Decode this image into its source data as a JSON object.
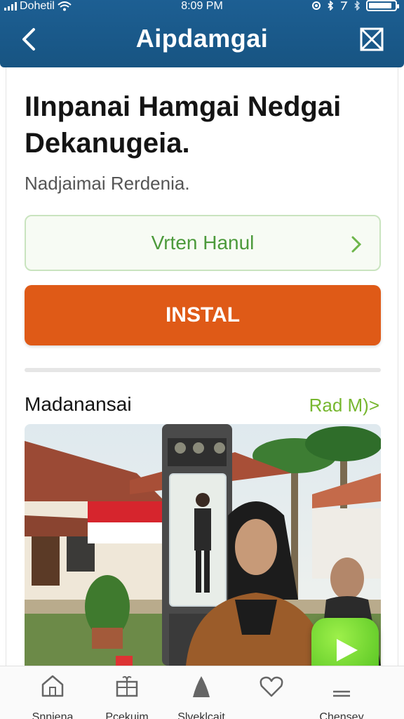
{
  "status_bar": {
    "carrier": "Dohetil",
    "time": "8:09 PM",
    "battery_level": 0.9
  },
  "header": {
    "title": "Aipdamgai",
    "back_icon": "chevron-left-icon",
    "close_icon": "close-box-icon"
  },
  "main": {
    "headline": "IInpanai Hamgai Nedgai Dekanugeia.",
    "subline": "Nadjaimai Rerdenia.",
    "link_row_label": "Vrten Hanul",
    "install_label": "INSTAL",
    "section_title": "Madanansai",
    "read_more": "Rad M)>"
  },
  "tabs": [
    {
      "label": "Snniena",
      "icon": "home-icon"
    },
    {
      "label": "Pcekuim",
      "icon": "gift-icon"
    },
    {
      "label": "Slveklcait",
      "icon": "person-icon"
    },
    {
      "label": "",
      "icon": "heart-icon"
    },
    {
      "label": "Chensey",
      "icon": "menu-icon"
    }
  ],
  "colors": {
    "header_blue": "#1a5a8c",
    "install_orange": "#df5a17",
    "accent_green": "#77b72f",
    "play_green": "#4fbf1e"
  }
}
